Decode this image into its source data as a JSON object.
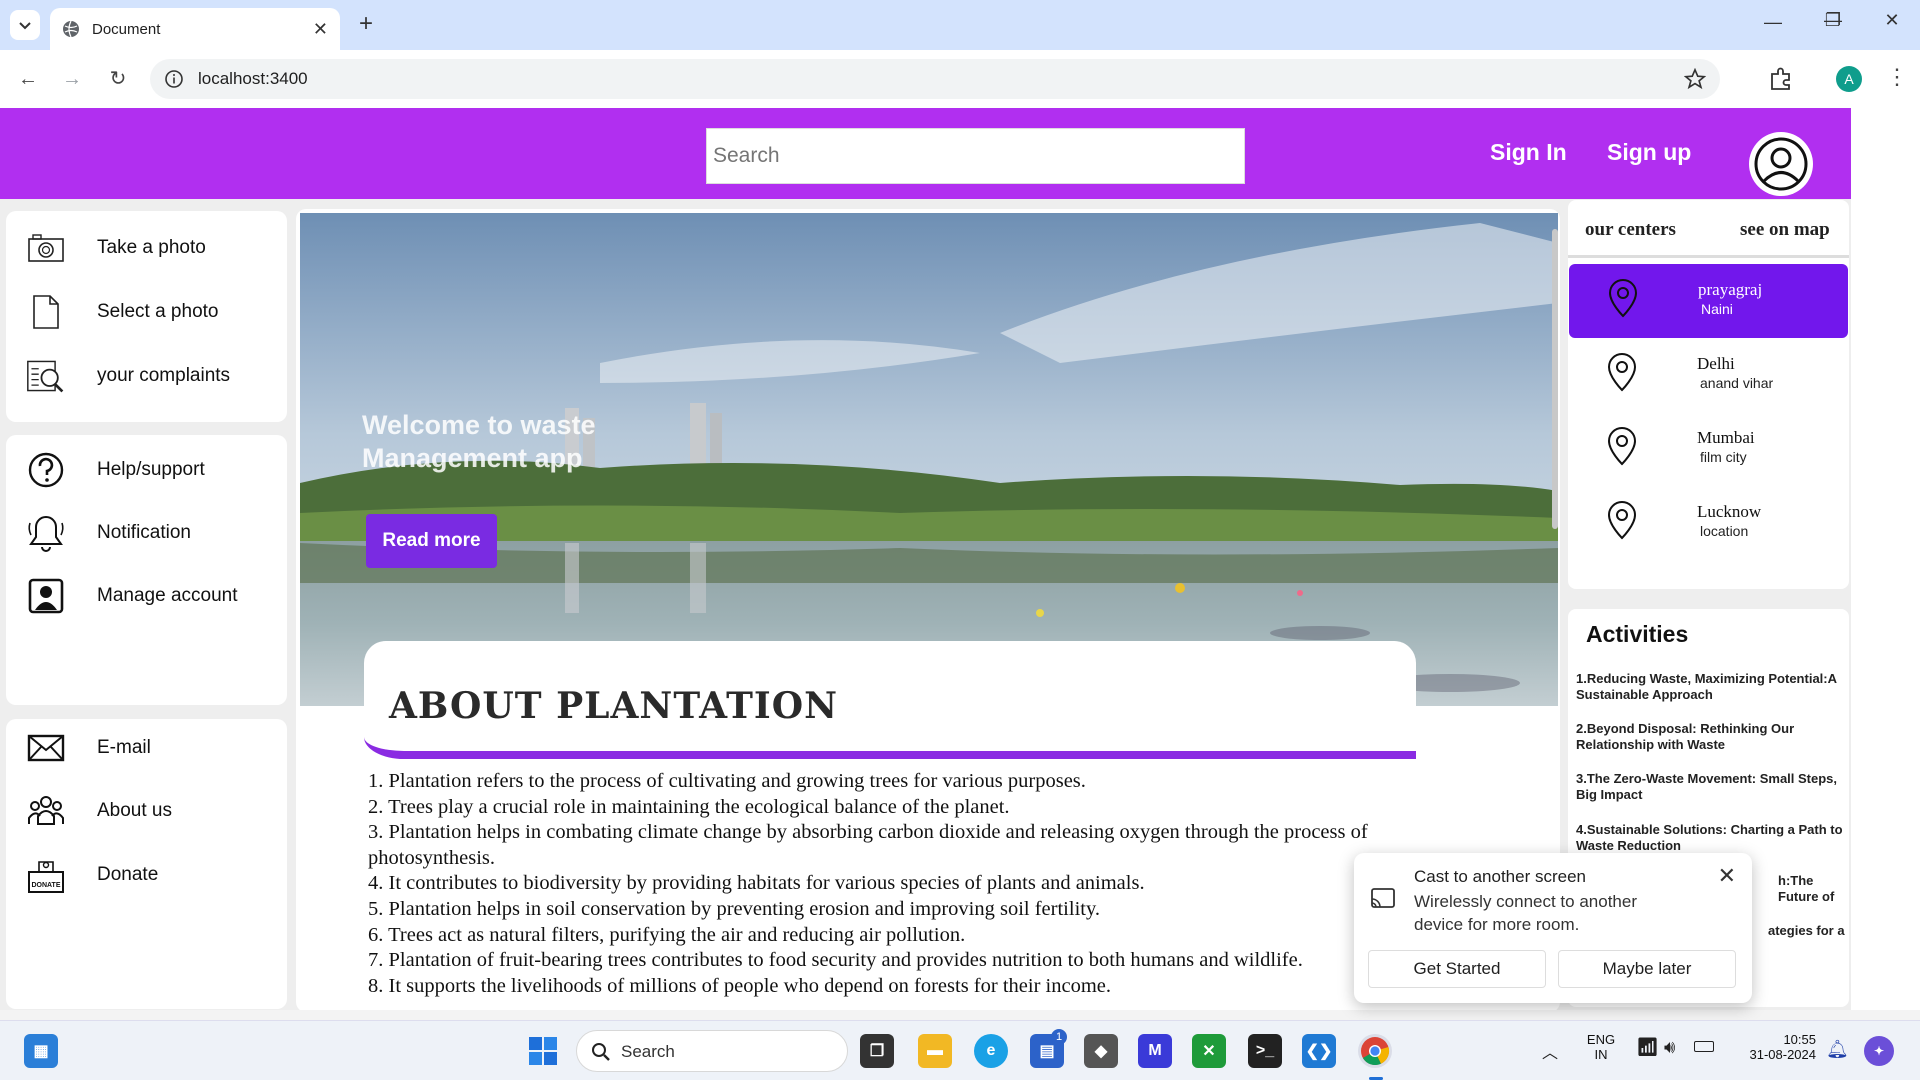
{
  "browser": {
    "tab_title": "Document",
    "url": "localhost:3400",
    "profile_initial": "A"
  },
  "header": {
    "search_placeholder": "Search",
    "sign_in": "Sign In",
    "sign_up": "Sign up"
  },
  "sidebar": {
    "group1": [
      {
        "label": "Take a photo",
        "icon": "camera-icon"
      },
      {
        "label": "Select a photo",
        "icon": "file-icon"
      },
      {
        "label": "your complaints",
        "icon": "complaints-icon"
      }
    ],
    "group2": [
      {
        "label": "Help/support",
        "icon": "help-icon"
      },
      {
        "label": "Notification",
        "icon": "bell-icon"
      },
      {
        "label": "Manage account",
        "icon": "account-icon"
      }
    ],
    "group3": [
      {
        "label": "E-mail",
        "icon": "mail-icon"
      },
      {
        "label": "About us",
        "icon": "team-icon"
      },
      {
        "label": "Donate",
        "icon": "donate-icon"
      }
    ]
  },
  "hero": {
    "title_line1": "Welcome to waste",
    "title_line2": "Management app",
    "button": "Read more"
  },
  "about": {
    "title": "ABOUT PLANTATION",
    "items": [
      "1. Plantation refers to the process of cultivating and growing trees for various purposes.",
      "2. Trees play a crucial role in maintaining the ecological balance of the planet.",
      "3. Plantation helps in combating climate change by absorbing carbon dioxide and releasing oxygen through the process of photosynthesis.",
      "4. It contributes to biodiversity by providing habitats for various species of plants and animals.",
      "5. Plantation helps in soil conservation by preventing erosion and improving soil fertility.",
      "6. Trees act as natural filters, purifying the air and reducing air pollution.",
      "7. Plantation of fruit-bearing trees contributes to food security and provides nutrition to both humans and wildlife.",
      "8. It supports the livelihoods of millions of people who depend on forests for their income."
    ]
  },
  "centers": {
    "heading": "our centers",
    "map_link": "see on map",
    "items": [
      {
        "city": "prayagraj",
        "area": "Naini"
      },
      {
        "city": "Delhi",
        "area": "anand vihar"
      },
      {
        "city": "Mumbai",
        "area": "film city"
      },
      {
        "city": "Lucknow",
        "area": "location"
      }
    ]
  },
  "activities": {
    "heading": "Activities",
    "items": [
      "1.Reducing Waste, Maximizing Potential:A Sustainable Approach",
      "2.Beyond Disposal: Rethinking Our Relationship with Waste",
      "3.The Zero-Waste Movement: Small Steps, Big Impact",
      "4.Sustainable Solutions: Charting a Path to Waste Reduction",
      "h:The Future of",
      "ategies for a"
    ]
  },
  "cast_popup": {
    "title": "Cast to another screen",
    "description": "Wirelessly connect to another device for more room.",
    "primary": "Get Started",
    "secondary": "Maybe later"
  },
  "taskbar": {
    "search": "Search",
    "lang_line1": "ENG",
    "lang_line2": "IN",
    "time": "10:55",
    "date": "31-08-2024",
    "store_badge": "1"
  }
}
